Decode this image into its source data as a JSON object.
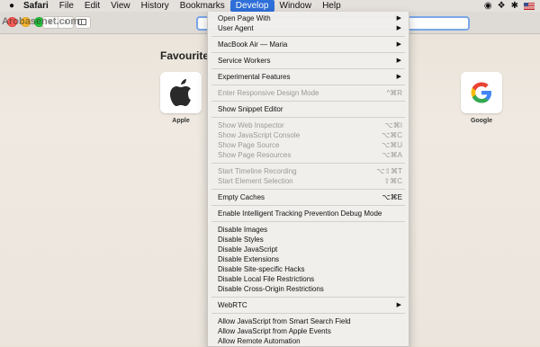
{
  "menubar": {
    "app": "Safari",
    "items": [
      "File",
      "Edit",
      "View",
      "History",
      "Bookmarks",
      "Develop",
      "Window",
      "Help"
    ],
    "active_index": 5
  },
  "watermark": "Arobasenet.com",
  "content": {
    "favourites_title": "Favourite",
    "tiles": [
      {
        "label": "Apple",
        "icon": "apple-logo-icon"
      },
      {
        "label": "Google",
        "icon": "google-logo-icon"
      }
    ]
  },
  "develop_menu": [
    {
      "label": "Open Page With",
      "submenu": true
    },
    {
      "label": "User Agent",
      "submenu": true
    },
    {
      "sep": true
    },
    {
      "label": "MacBook Air — Maria",
      "submenu": true
    },
    {
      "sep": true
    },
    {
      "label": "Service Workers",
      "submenu": true
    },
    {
      "sep": true
    },
    {
      "label": "Experimental Features",
      "submenu": true
    },
    {
      "sep": true
    },
    {
      "label": "Enter Responsive Design Mode",
      "shortcut": "^⌘R",
      "disabled": true
    },
    {
      "sep": true
    },
    {
      "label": "Show Snippet Editor"
    },
    {
      "sep": true
    },
    {
      "label": "Show Web Inspector",
      "shortcut": "⌥⌘I",
      "disabled": true
    },
    {
      "label": "Show JavaScript Console",
      "shortcut": "⌥⌘C",
      "disabled": true
    },
    {
      "label": "Show Page Source",
      "shortcut": "⌥⌘U",
      "disabled": true
    },
    {
      "label": "Show Page Resources",
      "shortcut": "⌥⌘A",
      "disabled": true
    },
    {
      "sep": true
    },
    {
      "label": "Start Timeline Recording",
      "shortcut": "⌥⇧⌘T",
      "disabled": true
    },
    {
      "label": "Start Element Selection",
      "shortcut": "⇧⌘C",
      "disabled": true
    },
    {
      "sep": true
    },
    {
      "label": "Empty Caches",
      "shortcut": "⌥⌘E"
    },
    {
      "sep": true
    },
    {
      "label": "Enable Intelligent Tracking Prevention Debug Mode"
    },
    {
      "sep": true
    },
    {
      "label": "Disable Images"
    },
    {
      "label": "Disable Styles"
    },
    {
      "label": "Disable JavaScript"
    },
    {
      "label": "Disable Extensions"
    },
    {
      "label": "Disable Site-specific Hacks"
    },
    {
      "label": "Disable Local File Restrictions"
    },
    {
      "label": "Disable Cross-Origin Restrictions"
    },
    {
      "sep": true
    },
    {
      "label": "WebRTC",
      "submenu": true
    },
    {
      "sep": true
    },
    {
      "label": "Allow JavaScript from Smart Search Field"
    },
    {
      "label": "Allow JavaScript from Apple Events"
    },
    {
      "label": "Allow Remote Automation"
    }
  ]
}
